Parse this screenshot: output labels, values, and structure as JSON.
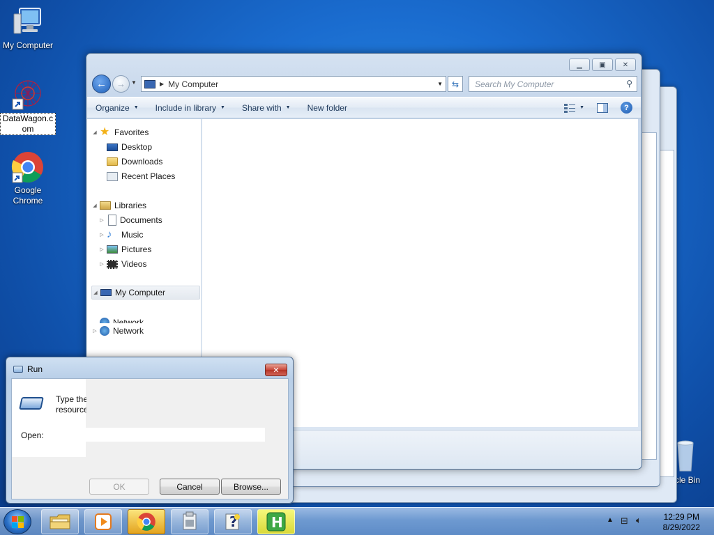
{
  "desktop": {
    "icons": [
      {
        "label": "My Computer"
      },
      {
        "label": "DataWagon.com",
        "label_line1": "DataWagon.c",
        "label_line2": "om"
      },
      {
        "label": "Google Chrome",
        "label_line1": "Google",
        "label_line2": "Chrome"
      },
      {
        "label": "cle Bin"
      }
    ]
  },
  "explorer": {
    "address": "My Computer",
    "search_placeholder": "Search My Computer",
    "toolbar": {
      "organize": "Organize",
      "include_in_library": "Include in library",
      "share_with": "Share with",
      "new_folder": "New folder"
    },
    "nav": {
      "favorites": "Favorites",
      "desktop": "Desktop",
      "downloads": "Downloads",
      "recent_places": "Recent Places",
      "libraries": "Libraries",
      "documents": "Documents",
      "music": "Music",
      "pictures": "Pictures",
      "videos": "Videos",
      "my_computer": "My Computer",
      "network_ghost": "Network",
      "network": "Network"
    }
  },
  "run_dialog": {
    "title": "Run",
    "description_line1": "Type the",
    "description_line2": "resource",
    "open_label": "Open:",
    "open_value": "",
    "ok": "OK",
    "cancel": "Cancel",
    "browse": "Browse..."
  },
  "taskbar": {
    "time": "12:29 PM",
    "date": "8/29/2022",
    "pinned": [
      "windows-explorer",
      "media-player",
      "google-chrome",
      "document-manager",
      "help-and-support",
      "h-app"
    ]
  },
  "colors": {
    "desktop_blue": "#1a6ccf",
    "window_frame": "#c8d8ec",
    "close_red": "#c8473a",
    "active_taskbar_item": "#e3a31e"
  }
}
